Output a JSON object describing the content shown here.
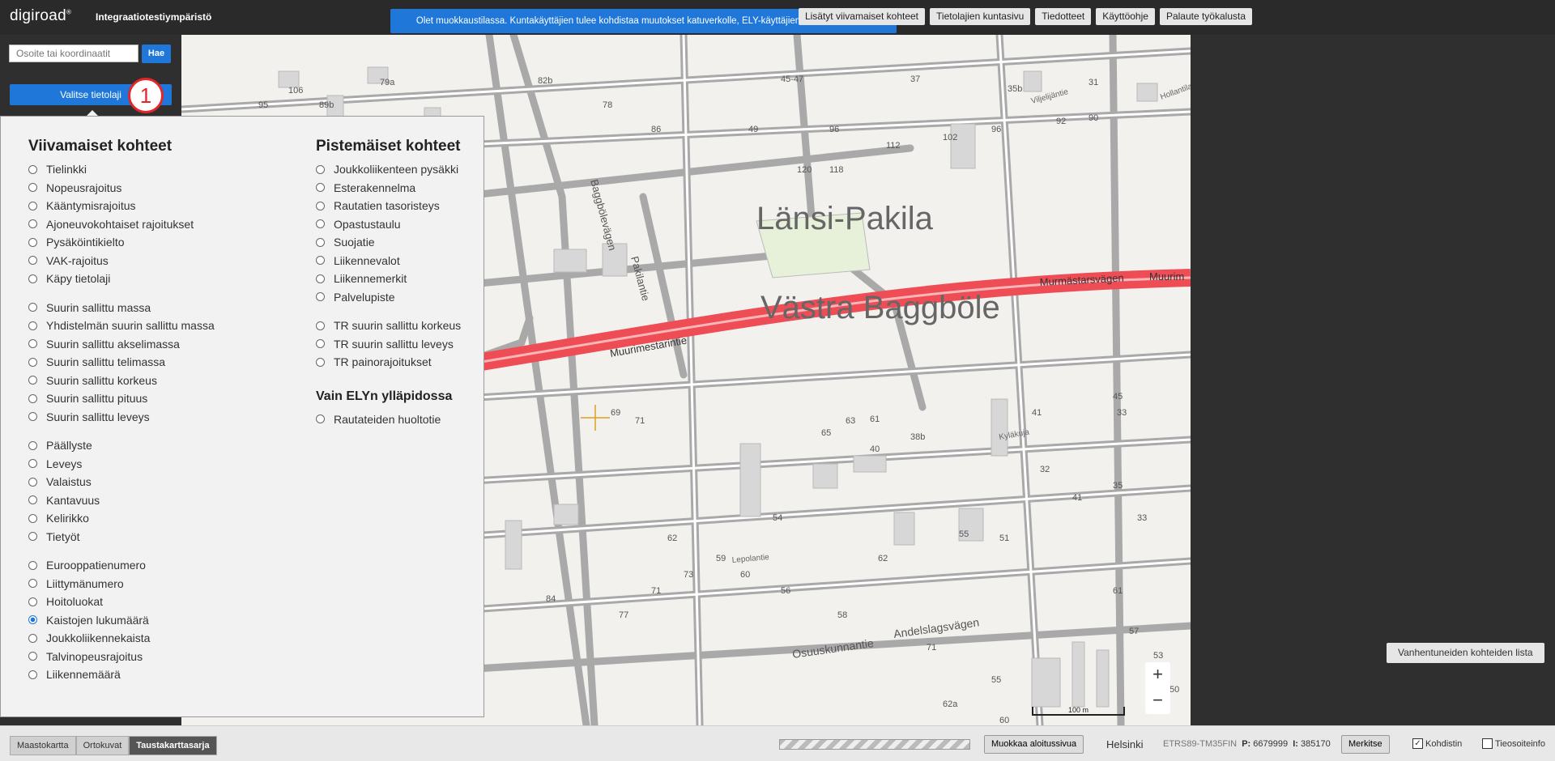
{
  "header": {
    "logo": "digiroad",
    "environment": "Integraatiotestiympäristö",
    "notice": "Olet muokkaustilassa. Kuntakäyttäjien tulee kohdistaa muutokset katuverkolle, ELY-käyttäjien maantieverkolle.",
    "buttons": [
      "Lisätyt viivamaiset kohteet",
      "Tietolajien kuntasivu",
      "Tiedotteet",
      "Käyttöohje",
      "Palaute työkalusta"
    ]
  },
  "search": {
    "placeholder": "Osoite tai koordinaatit",
    "button_label": "Hae"
  },
  "layer_selector": {
    "button_label": "Valitse tietolaji",
    "badge_number": "1"
  },
  "layer_panel": {
    "linear": {
      "title": "Viivamaiset kohteet",
      "groups": [
        [
          "Tielinkki",
          "Nopeusrajoitus",
          "Kääntymisrajoitus",
          "Ajoneuvokohtaiset rajoitukset",
          "Pysäköintikielto",
          "VAK-rajoitus",
          "Käpy tietolaji"
        ],
        [
          "Suurin sallittu massa",
          "Yhdistelmän suurin sallittu massa",
          "Suurin sallittu akselimassa",
          "Suurin sallittu telimassa",
          "Suurin sallittu korkeus",
          "Suurin sallittu pituus",
          "Suurin sallittu leveys"
        ],
        [
          "Päällyste",
          "Leveys",
          "Valaistus",
          "Kantavuus",
          "Kelirikko",
          "Tietyöt"
        ],
        [
          "Eurooppatienumero",
          "Liittymänumero",
          "Hoitoluokat",
          "Kaistojen lukumäärä",
          "Joukkoliikennekaista",
          "Talvinopeusrajoitus",
          "Liikennemäärä"
        ]
      ],
      "selected": "Kaistojen lukumäärä"
    },
    "point": {
      "title": "Pistemäiset kohteet",
      "groups": [
        [
          "Joukkoliikenteen pysäkki",
          "Esterakennelma",
          "Rautatien tasoristeys",
          "Opastustaulu",
          "Suojatie",
          "Liikennevalot",
          "Liikennemerkit",
          "Palvelupiste"
        ],
        [
          "TR suurin sallittu korkeus",
          "TR suurin sallittu leveys",
          "TR painorajoitukset"
        ]
      ]
    },
    "ely": {
      "title": "Vain ELYn ylläpidossa",
      "items": [
        "Rautateiden huoltotie"
      ]
    }
  },
  "map": {
    "labels": {
      "area_fi": "Länsi-Pakila",
      "area_sv": "Västra Baggböle",
      "road_murmastars": "Murmästarsvägen",
      "road_muurim": "Muurim",
      "road_muurimestarintie": "Muurimestarintie",
      "road_baggbole": "Baggbölevägen",
      "road_pakilantie": "Pakilantie",
      "road_osuuskunnantie": "Osuuskunnantie",
      "road_andelslags": "Andelslagsvägen",
      "road_lepolantie": "Lepolantie",
      "road_viljelijantie": "Viljelijäntie",
      "road_kyla": "Kyläkuja",
      "road_hollandarintie": "Hollantilaisentie",
      "scale": "100 m"
    },
    "zoom_in": "+",
    "zoom_out": "−"
  },
  "right_panel": {
    "outdated_button": "Vanhentuneiden kohteiden lista"
  },
  "footer": {
    "basemap_tabs": [
      "Maastokartta",
      "Ortokuvat",
      "Taustakarttasarja"
    ],
    "active_tab": "Taustakarttasarja",
    "edit_start_button": "Muokkaa aloitussivua",
    "city": "Helsinki",
    "projection": "ETRS89-TM35FIN",
    "p_label": "P:",
    "p_value": "6679999",
    "i_label": "I:",
    "i_value": "385170",
    "mark_button": "Merkitse",
    "cursor_label": "Kohdistin",
    "cursor_checked": true,
    "road_address_label": "Tieosoiteinfo",
    "road_address_checked": false
  }
}
